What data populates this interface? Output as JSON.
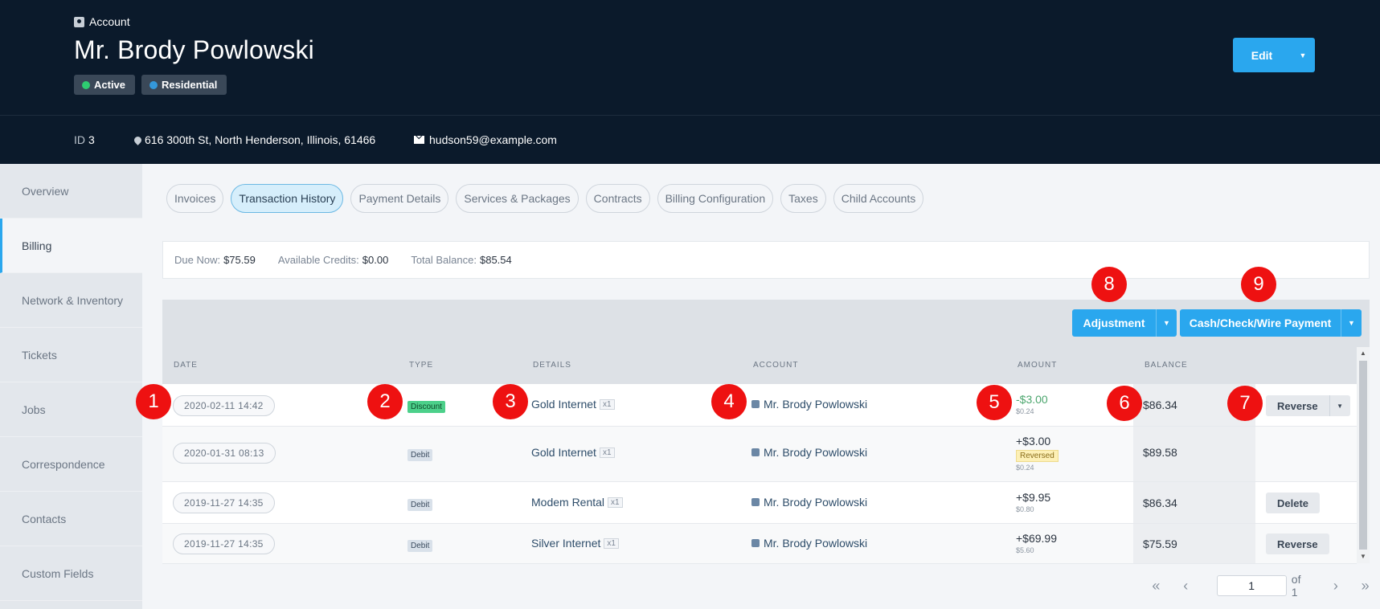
{
  "header": {
    "section_label": "Account",
    "name": "Mr. Brody Powlowski",
    "badges": [
      {
        "label": "Active",
        "color": "#2ecc71"
      },
      {
        "label": "Residential",
        "color": "#3498db"
      }
    ],
    "edit_label": "Edit"
  },
  "subheader": {
    "id_label": "ID",
    "id_value": "3",
    "address": "616 300th St, North Henderson, Illinois, 61466",
    "email": "hudson59@example.com"
  },
  "sidebar": {
    "items": [
      {
        "label": "Overview"
      },
      {
        "label": "Billing"
      },
      {
        "label": "Network & Inventory"
      },
      {
        "label": "Tickets"
      },
      {
        "label": "Jobs"
      },
      {
        "label": "Correspondence"
      },
      {
        "label": "Contacts"
      },
      {
        "label": "Custom Fields"
      }
    ],
    "active": "Billing"
  },
  "tabs": [
    {
      "label": "Invoices"
    },
    {
      "label": "Transaction History"
    },
    {
      "label": "Payment Details"
    },
    {
      "label": "Services & Packages"
    },
    {
      "label": "Contracts"
    },
    {
      "label": "Billing Configuration"
    },
    {
      "label": "Taxes"
    },
    {
      "label": "Child Accounts"
    }
  ],
  "active_tab": "Transaction History",
  "summary": {
    "due_now_label": "Due Now:",
    "due_now": "$75.59",
    "credits_label": "Available Credits:",
    "credits": "$0.00",
    "total_label": "Total Balance:",
    "total": "$85.54"
  },
  "toolbar": {
    "adjustment_label": "Adjustment",
    "payment_label": "Cash/Check/Wire Payment"
  },
  "table": {
    "columns": {
      "date": "DATE",
      "type": "TYPE",
      "details": "DETAILS",
      "account": "ACCOUNT",
      "amount": "AMOUNT",
      "balance": "BALANCE"
    },
    "rows": [
      {
        "date": "2020-02-11 14:42",
        "type": "Discount",
        "details": "Gold Internet",
        "qty": "x1",
        "account": "Mr. Brody Powlowski",
        "amount": "-$3.00",
        "amount_sub": "$0.24",
        "reversed": "",
        "balance": "$86.34",
        "action": "Reverse"
      },
      {
        "date": "2020-01-31 08:13",
        "type": "Debit",
        "details": "Gold Internet",
        "qty": "x1",
        "account": "Mr. Brody Powlowski",
        "amount": "+$3.00",
        "amount_sub": "$0.24",
        "reversed": "Reversed",
        "balance": "$89.58",
        "action": ""
      },
      {
        "date": "2019-11-27 14:35",
        "type": "Debit",
        "details": "Modem Rental",
        "qty": "x1",
        "account": "Mr. Brody Powlowski",
        "amount": "+$9.95",
        "amount_sub": "$0.80",
        "reversed": "",
        "balance": "$86.34",
        "action": "Delete"
      },
      {
        "date": "2019-11-27 14:35",
        "type": "Debit",
        "details": "Silver Internet",
        "qty": "x1",
        "account": "Mr. Brody Powlowski",
        "amount": "+$69.99",
        "amount_sub": "$5.60",
        "reversed": "",
        "balance": "$75.59",
        "action": "Reverse"
      }
    ]
  },
  "markers": [
    "1",
    "2",
    "3",
    "4",
    "5",
    "6",
    "7",
    "8",
    "9"
  ],
  "pagination": {
    "current": "1",
    "of_label": "of 1",
    "first": "«",
    "prev": "‹",
    "next": "›",
    "last": "»"
  },
  "colors": {
    "header_bg": "#0b1a2b",
    "accent": "#2aa7ee",
    "marker": "#ee1111"
  }
}
